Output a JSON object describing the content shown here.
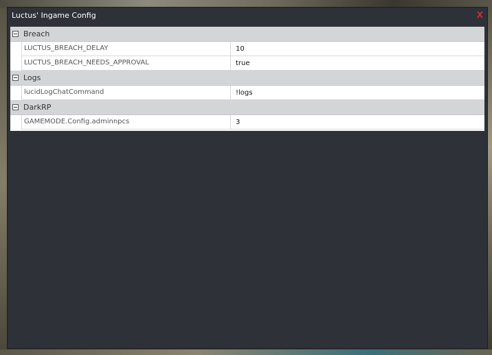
{
  "window": {
    "title": "Luctus' Ingame Config",
    "close_label": "X"
  },
  "categories": [
    {
      "label": "Breach",
      "rows": [
        {
          "key": "LUCTUS_BREACH_DELAY",
          "value": "10"
        },
        {
          "key": "LUCTUS_BREACH_NEEDS_APPROVAL",
          "value": "true"
        }
      ]
    },
    {
      "label": "Logs",
      "rows": [
        {
          "key": "lucidLogChatCommand",
          "value": "!logs"
        }
      ]
    },
    {
      "label": "DarkRP",
      "rows": [
        {
          "key": "GAMEMODE.Config.adminnpcs",
          "value": "3"
        }
      ]
    }
  ],
  "colors": {
    "window_bg": "#2f3139",
    "close": "#d22a2a",
    "category_bg": "#d4d5d7"
  },
  "icons": {
    "toggle": "collapse-minus-icon"
  }
}
